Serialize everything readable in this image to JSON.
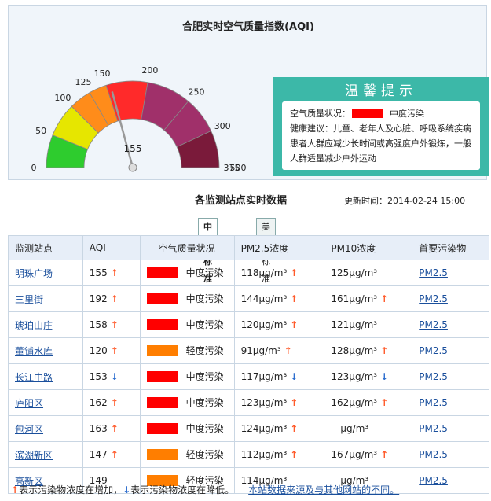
{
  "header": {
    "title": "合肥实时空气质量指数(AQI)"
  },
  "gauge": {
    "ticks": [
      "0",
      "50",
      "100",
      "125",
      "150",
      "200",
      "250",
      "300",
      "375",
      "500"
    ],
    "value": 155,
    "value_label": "155",
    "colors": {
      "green": "#2ecc2e",
      "yellow": "#e6e600",
      "orange": "#ff8c1a",
      "red": "#ff2a2a",
      "purple": "#a0306a",
      "maroon": "#7a1a3a"
    }
  },
  "tip": {
    "title": "温馨提示",
    "status_label": "空气质量状况：",
    "status_color": "#ff0000",
    "status_text": "中度污染",
    "advice": "健康建议：儿童、老年人及心脏、呼吸系统疾病患者人群应减少长时间或高强度户外锻炼，一般人群适量减少户外运动"
  },
  "section": {
    "title": "各监测站点实时数据",
    "update": "更新时间：2014-02-24 15:00"
  },
  "tabs": [
    "中国标准",
    "美国标准"
  ],
  "table": {
    "headers": [
      "监测站点",
      "AQI",
      "空气质量状况",
      "PM2.5浓度",
      "PM10浓度",
      "首要污染物"
    ],
    "rows": [
      {
        "station": "明珠广场",
        "aqi": "155",
        "aqi_trend": "up",
        "level": "中度污染",
        "level_color": "#ff0000",
        "pm25": "118μg/m³",
        "pm25_trend": "up",
        "pm10": "125μg/m³",
        "pm10_trend": "",
        "primary": "PM2.5"
      },
      {
        "station": "三里街",
        "aqi": "192",
        "aqi_trend": "up",
        "level": "中度污染",
        "level_color": "#ff0000",
        "pm25": "144μg/m³",
        "pm25_trend": "up",
        "pm10": "161μg/m³",
        "pm10_trend": "up",
        "primary": "PM2.5"
      },
      {
        "station": "琥珀山庄",
        "aqi": "158",
        "aqi_trend": "up",
        "level": "中度污染",
        "level_color": "#ff0000",
        "pm25": "120μg/m³",
        "pm25_trend": "up",
        "pm10": "121μg/m³",
        "pm10_trend": "",
        "primary": "PM2.5"
      },
      {
        "station": "董铺水库",
        "aqi": "120",
        "aqi_trend": "up",
        "level": "轻度污染",
        "level_color": "#ff7e00",
        "pm25": "91μg/m³",
        "pm25_trend": "up",
        "pm10": "128μg/m³",
        "pm10_trend": "up",
        "primary": "PM2.5"
      },
      {
        "station": "长江中路",
        "aqi": "153",
        "aqi_trend": "down",
        "level": "中度污染",
        "level_color": "#ff0000",
        "pm25": "117μg/m³",
        "pm25_trend": "down",
        "pm10": "123μg/m³",
        "pm10_trend": "down",
        "primary": "PM2.5"
      },
      {
        "station": "庐阳区",
        "aqi": "162",
        "aqi_trend": "up",
        "level": "中度污染",
        "level_color": "#ff0000",
        "pm25": "123μg/m³",
        "pm25_trend": "up",
        "pm10": "162μg/m³",
        "pm10_trend": "up",
        "primary": "PM2.5"
      },
      {
        "station": "包河区",
        "aqi": "163",
        "aqi_trend": "up",
        "level": "中度污染",
        "level_color": "#ff0000",
        "pm25": "124μg/m³",
        "pm25_trend": "up",
        "pm10": "—μg/m³",
        "pm10_trend": "",
        "primary": "PM2.5"
      },
      {
        "station": "滨湖新区",
        "aqi": "147",
        "aqi_trend": "up",
        "level": "轻度污染",
        "level_color": "#ff7e00",
        "pm25": "112μg/m³",
        "pm25_trend": "up",
        "pm10": "167μg/m³",
        "pm10_trend": "up",
        "primary": "PM2.5"
      },
      {
        "station": "高新区",
        "aqi": "149",
        "aqi_trend": "",
        "level": "轻度污染",
        "level_color": "#ff7e00",
        "pm25": "114μg/m³",
        "pm25_trend": "",
        "pm10": "—μg/m³",
        "pm10_trend": "",
        "primary": "PM2.5"
      }
    ]
  },
  "footer": {
    "up_text": "表示污染物浓度在增加，",
    "down_text": "表示污染物浓度在降低。",
    "link": "本站数据来源及与其他网站的不同。"
  }
}
